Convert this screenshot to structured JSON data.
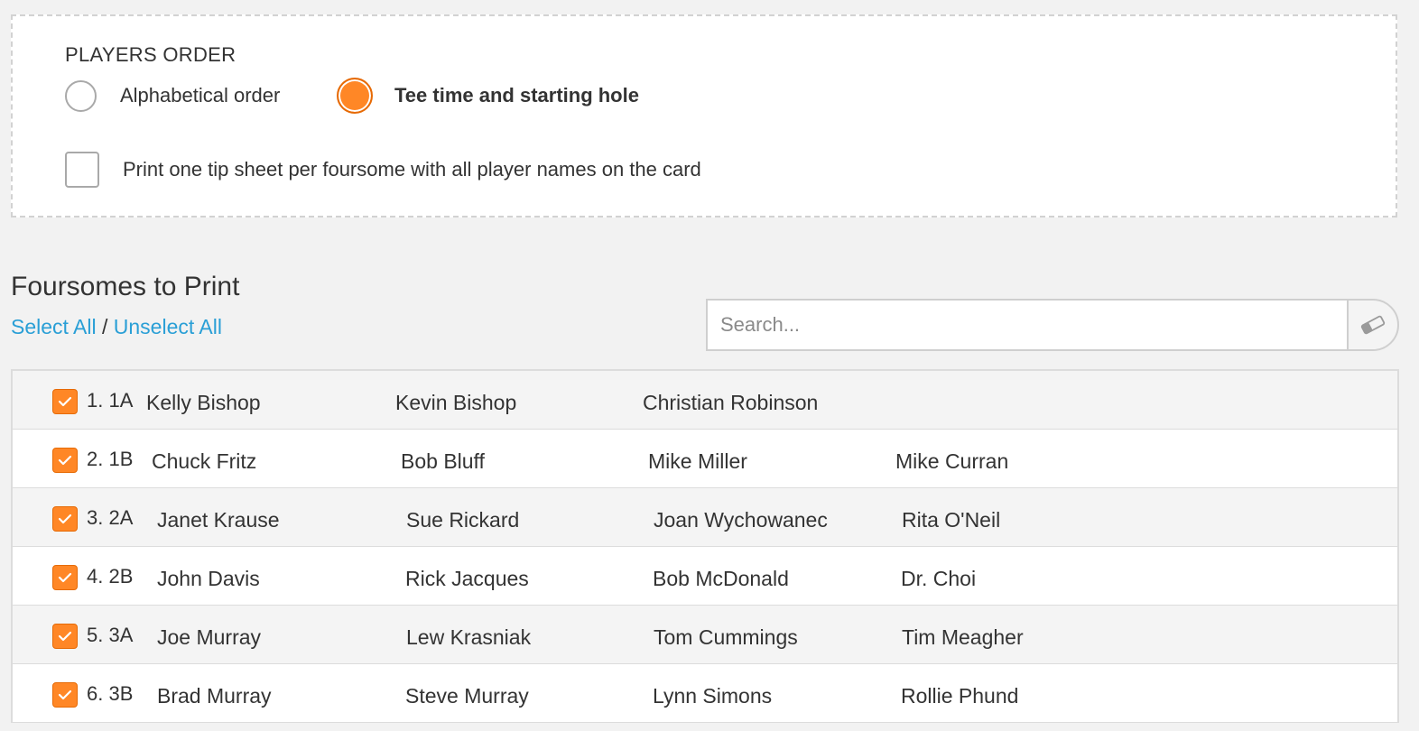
{
  "options": {
    "heading": "PLAYERS ORDER",
    "radio_alpha_label": "Alphabetical order",
    "radio_tee_label": "Tee time and starting hole",
    "selected": "tee",
    "tip_label": "Print one tip sheet per foursome with all player names on the card",
    "tip_checked": false
  },
  "foursomes": {
    "title": "Foursomes to Print",
    "select_all": "Select All",
    "separator": " / ",
    "unselect_all": "Unselect All"
  },
  "search": {
    "placeholder": "Search..."
  },
  "colors": {
    "accent": "#ff8726",
    "link": "#2a9fd6"
  },
  "rows": [
    {
      "label": "1. 1A",
      "checked": true,
      "players": [
        "Kelly Bishop",
        "Kevin Bishop",
        "Christian Robinson"
      ]
    },
    {
      "label": "2. 1B",
      "checked": true,
      "players": [
        "Chuck Fritz",
        "Bob Bluff",
        "Mike Miller",
        "Mike Curran"
      ]
    },
    {
      "label": "3. 2A",
      "checked": true,
      "players": [
        "Janet Krause",
        "Sue Rickard",
        "Joan Wychowanec",
        "Rita O'Neil"
      ]
    },
    {
      "label": "4. 2B",
      "checked": true,
      "players": [
        "John Davis",
        "Rick Jacques",
        "Bob McDonald",
        "Dr. Choi"
      ]
    },
    {
      "label": "5. 3A",
      "checked": true,
      "players": [
        "Joe Murray",
        "Lew Krasniak",
        "Tom Cummings",
        "Tim Meagher"
      ]
    },
    {
      "label": "6. 3B",
      "checked": true,
      "players": [
        "Brad Murray",
        "Steve Murray",
        "Lynn Simons",
        "Rollie Phund"
      ]
    }
  ]
}
